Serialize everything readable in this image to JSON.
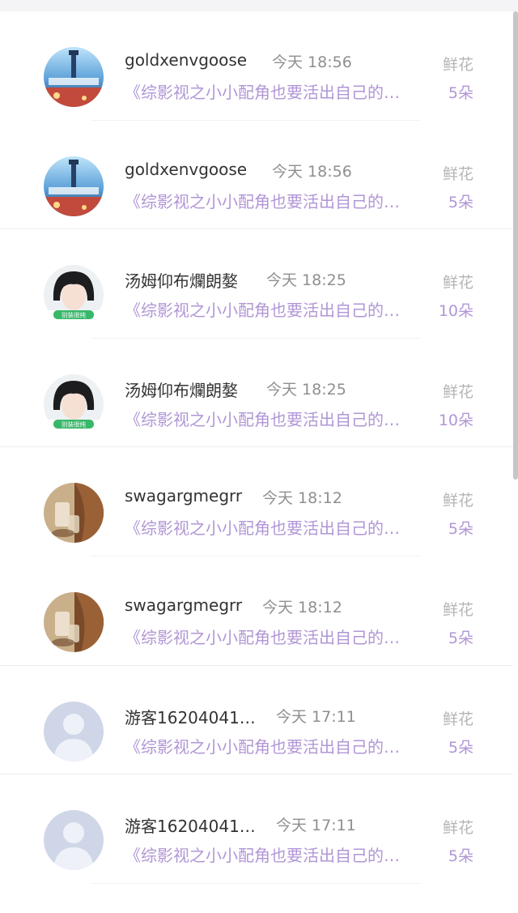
{
  "entries": [
    {
      "avatar": "city-night-avatar",
      "name": "goldxenvgoose",
      "time": "今天 18:56",
      "gift": "鲜花",
      "book": "《综影视之小小配角也要活出自己的…",
      "qty": "5朵"
    },
    {
      "avatar": "city-night-avatar",
      "name": "goldxenvgoose",
      "time": "今天 18:56",
      "gift": "鲜花",
      "book": "《综影视之小小配角也要活出自己的…",
      "qty": "5朵"
    },
    {
      "avatar": "girl-portrait-avatar",
      "name": "汤姆仰布爛朗嫯",
      "time": "今天 18:25",
      "gift": "鲜花",
      "book": "《综影视之小小配角也要活出自己的…",
      "qty": "10朵",
      "avatar_badge": "别装很纯"
    },
    {
      "avatar": "girl-portrait-avatar",
      "name": "汤姆仰布爛朗嫯",
      "time": "今天 18:25",
      "gift": "鲜花",
      "book": "《综影视之小小配角也要活出自己的…",
      "qty": "10朵",
      "avatar_badge": "别装很纯"
    },
    {
      "avatar": "sepia-photo-avatar",
      "name": "swagargmegrr",
      "time": "今天 18:12",
      "gift": "鲜花",
      "book": "《综影视之小小配角也要活出自己的…",
      "qty": "5朵"
    },
    {
      "avatar": "sepia-photo-avatar",
      "name": "swagargmegrr",
      "time": "今天 18:12",
      "gift": "鲜花",
      "book": "《综影视之小小配角也要活出自己的…",
      "qty": "5朵"
    },
    {
      "avatar": "default-user-avatar",
      "name": "游客16204041…",
      "time": "今天 17:11",
      "gift": "鲜花",
      "book": "《综影视之小小配角也要活出自己的…",
      "qty": "5朵"
    },
    {
      "avatar": "default-user-avatar",
      "name": "游客16204041…",
      "time": "今天 17:11",
      "gift": "鲜花",
      "book": "《综影视之小小配角也要活出自己的…",
      "qty": "5朵"
    }
  ],
  "colors": {
    "name": "#333333",
    "time": "#8f8f8f",
    "gift": "#b5b5b5",
    "accent": "#b196d6",
    "default_avatar": "#cfd6e8"
  }
}
